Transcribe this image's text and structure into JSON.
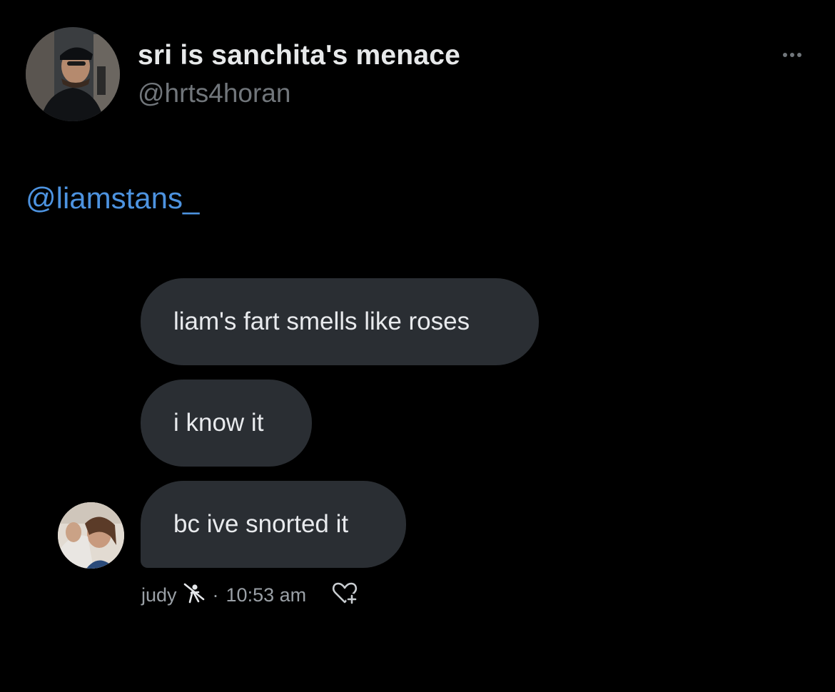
{
  "tweet": {
    "author": {
      "display_name": "sri is sanchita's menace",
      "handle": "@hrts4horan"
    },
    "mention": "@liamstans_",
    "more_icon": "more-horizontal-icon"
  },
  "chat": {
    "messages": [
      {
        "text": "liam's fart smells like roses"
      },
      {
        "text": "i know it"
      },
      {
        "text": "bc ive snorted it"
      }
    ],
    "sender_name": "judy",
    "sender_badge_icon": "fencer-emoji-icon",
    "separator": "·",
    "timestamp": "10:53 am",
    "react_icon": "heart-plus-icon"
  },
  "colors": {
    "background": "#000000",
    "link": "#4d93e0",
    "bubble": "#2a2e33",
    "muted": "#71767b"
  }
}
